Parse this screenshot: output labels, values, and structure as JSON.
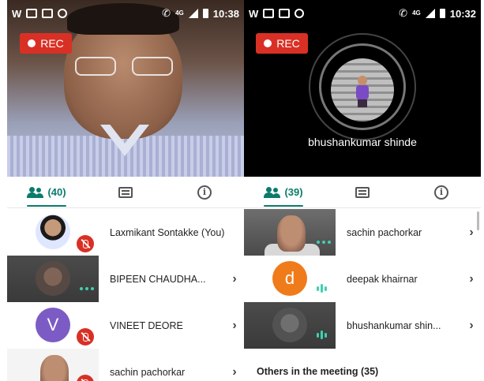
{
  "left_screen": {
    "status": {
      "time": "10:38",
      "network": "4G"
    },
    "rec_label": "REC",
    "tabs": {
      "people_count": "(40)"
    },
    "participants": [
      {
        "name": "Laxmikant Sontakke (You)",
        "muted": true,
        "chevron": ""
      },
      {
        "name": "BIPEEN CHAUDHA...",
        "muted": false,
        "chevron": "›"
      },
      {
        "name": "VINEET DEORE",
        "initial": "V",
        "muted": true,
        "chevron": "›",
        "avatar_color": "#7c5cc4"
      },
      {
        "name": "sachin pachorkar",
        "muted": true,
        "chevron": "›"
      }
    ]
  },
  "right_screen": {
    "status": {
      "time": "10:32",
      "network": "4G"
    },
    "rec_label": "REC",
    "caller_name": "bhushankumar shinde",
    "tabs": {
      "people_count": "(39)"
    },
    "participants": [
      {
        "name": "sachin pachorkar",
        "chevron": "›"
      },
      {
        "name": "deepak khairnar",
        "initial": "d",
        "chevron": "›",
        "avatar_color": "#f07b1a"
      },
      {
        "name": "bhushankumar shin...",
        "chevron": "›"
      }
    ],
    "others_label": "Others in the meeting (35)"
  },
  "colors": {
    "accent": "#0b7b6b",
    "rec": "#d93025",
    "speaking": "#3ed1b0"
  }
}
